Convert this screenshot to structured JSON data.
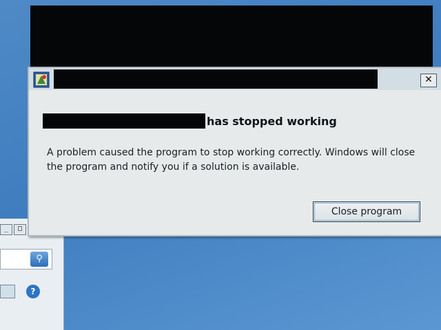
{
  "dialog": {
    "heading_suffix": "has stopped working",
    "message": "A problem caused the program to stop working correctly. Windows will close the program and notify you if a solution is available.",
    "close_glyph": "✕",
    "primary_button": "Close program"
  },
  "icons": {
    "app": "program-icon",
    "close": "close-icon",
    "search": "search-icon",
    "help": "help-icon"
  },
  "left_window": {
    "minimize_glyph": "_",
    "maximize_glyph": "□",
    "search_glyph": "⚲",
    "help_glyph": "?"
  }
}
